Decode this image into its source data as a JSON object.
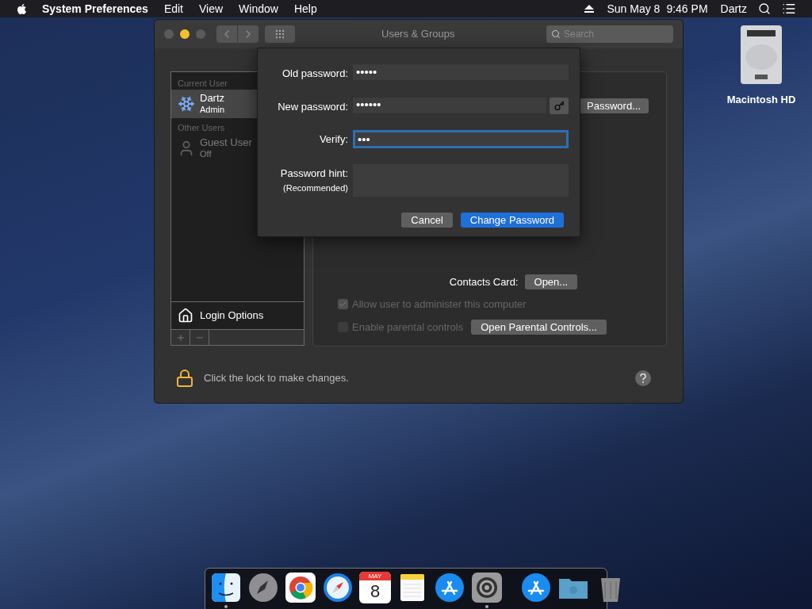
{
  "menu_bar": {
    "app": "System Preferences",
    "menus": [
      "Edit",
      "View",
      "Window",
      "Help"
    ],
    "date": "Sun May 8",
    "time": "9:46 PM",
    "user": "Dartz"
  },
  "desktop_icons": [
    {
      "label": "Macintosh HD"
    }
  ],
  "window": {
    "title": "Users & Groups",
    "search": {
      "placeholder": "Search"
    }
  },
  "sidebar": {
    "sections": [
      {
        "header": "Current User",
        "users": [
          {
            "name": "Dartz",
            "role": "Admin",
            "selected": true,
            "disabled": false
          }
        ]
      },
      {
        "header": "Other Users",
        "users": [
          {
            "name": "Guest User",
            "role": "Off",
            "selected": false,
            "disabled": true
          }
        ]
      }
    ],
    "login_options": "Login Options"
  },
  "account_panel": {
    "password_button": "Password...",
    "contacts_label": "Contacts Card:",
    "contacts_button": "Open...",
    "checkboxes": [
      {
        "label": "Allow user to administer this computer",
        "checked": true,
        "disabled": true
      },
      {
        "label": "Enable parental controls",
        "checked": false,
        "disabled": true,
        "button": "Open Parental Controls..."
      }
    ]
  },
  "lock": {
    "message": "Click the lock to make changes."
  },
  "sheet": {
    "fields": [
      {
        "label": "Old password:",
        "value": "•••••",
        "kind": "password",
        "focused": false
      },
      {
        "label": "New password:",
        "value": "••••••",
        "kind": "password_assist",
        "focused": false
      },
      {
        "label": "Verify:",
        "value": "•••",
        "kind": "password",
        "focused": true
      },
      {
        "label": "Password hint:",
        "sublabel": "(Recommended)",
        "kind": "hint",
        "focused": false
      }
    ],
    "buttons": [
      {
        "label": "Cancel",
        "primary": false
      },
      {
        "label": "Change Password",
        "primary": true
      }
    ]
  },
  "dock": {
    "apps": [
      {
        "kind": "finder",
        "running": true
      },
      {
        "kind": "launchpad",
        "running": false
      },
      {
        "kind": "chrome",
        "running": false
      },
      {
        "kind": "safari",
        "running": false
      },
      {
        "kind": "calendar",
        "month": "MAY",
        "day": "8",
        "running": false
      },
      {
        "kind": "notes",
        "running": false
      },
      {
        "kind": "appstore",
        "running": false
      },
      {
        "kind": "settings",
        "running": true
      }
    ],
    "others": [
      {
        "kind": "appstore_download",
        "running": false
      },
      {
        "kind": "folder",
        "running": false
      },
      {
        "kind": "trash",
        "running": false
      }
    ]
  }
}
